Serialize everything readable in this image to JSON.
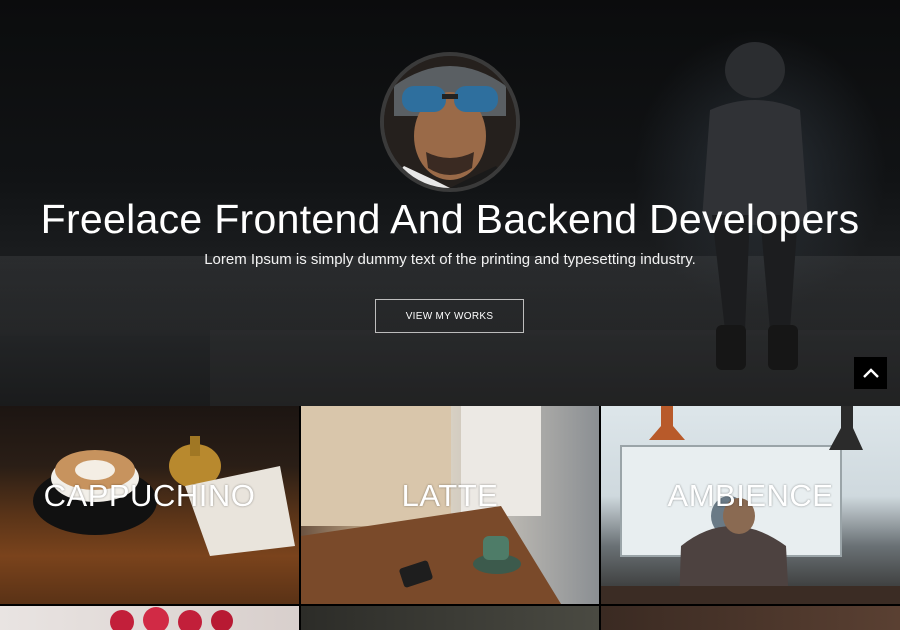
{
  "hero": {
    "title": "Freelace Frontend And Backend Developers",
    "subtitle": "Lorem Ipsum is simply dummy text of the printing and typesetting industry.",
    "cta_label": "VIEW MY WORKS"
  },
  "back_to_top": {
    "icon": "chevron-up-icon"
  },
  "gallery": {
    "tiles": [
      {
        "label": "CAPPUCHINO"
      },
      {
        "label": "LATTE"
      },
      {
        "label": "AMBIENCE"
      }
    ]
  },
  "colors": {
    "overlay": "#000000",
    "text": "#ffffff",
    "button_border": "#bdbdbd"
  }
}
